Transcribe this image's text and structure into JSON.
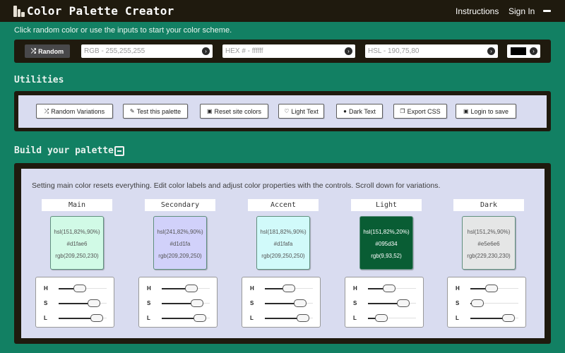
{
  "header": {
    "title": "Color Palette Creator",
    "nav": [
      "Instructions",
      "Sign In"
    ]
  },
  "intro": "Click random color or use the inputs to start your color scheme.",
  "inputs": {
    "random_label": "Random",
    "rgb_placeholder": "RGB - 255,255,255",
    "hex_placeholder": "HEX # - ffffff",
    "hsl_placeholder": "HSL - 190,75,80",
    "swatch_color": "#000000"
  },
  "utilities": {
    "title": "Utilities",
    "buttons": [
      "Random Variations",
      "Test this palette",
      "Reset site colors",
      "Light Text",
      "Dark Text",
      "Export CSS",
      "Login to save"
    ]
  },
  "build": {
    "title": "Build your palette",
    "hint": "Setting main color resets everything. Edit color labels and adjust color properties with the controls. Scroll down for variations.",
    "slider_labels": [
      "H",
      "S",
      "L"
    ],
    "colors": [
      {
        "label": "Main",
        "hsl": "hsl(151,82%,90%)",
        "hex": "#d1fae6",
        "rgb": "rgb(209,250,230)",
        "bg": "#d1fae6",
        "text_color": "#555555",
        "h": 151,
        "s": 82,
        "l": 90
      },
      {
        "label": "Secondary",
        "hsl": "hsl(241,82%,90%)",
        "hex": "#d1d1fa",
        "rgb": "rgb(209,209,250)",
        "bg": "#d1d1fa",
        "text_color": "#555555",
        "h": 241,
        "s": 82,
        "l": 90
      },
      {
        "label": "Accent",
        "hsl": "hsl(181,82%,90%)",
        "hex": "#d1fafa",
        "rgb": "rgb(209,250,250)",
        "bg": "#d1fafa",
        "text_color": "#555555",
        "h": 181,
        "s": 82,
        "l": 90
      },
      {
        "label": "Light",
        "hsl": "hsl(151,82%,20%)",
        "hex": "#095d34",
        "rgb": "rgb(9,93,52)",
        "bg": "#095d34",
        "text_color": "#ffffff",
        "h": 151,
        "s": 82,
        "l": 20
      },
      {
        "label": "Dark",
        "hsl": "hsl(151,2%,90%)",
        "hex": "#e5e6e6",
        "rgb": "rgb(229,230,230)",
        "bg": "#e5e6e6",
        "text_color": "#555555",
        "h": 151,
        "s": 2,
        "l": 90
      }
    ]
  }
}
